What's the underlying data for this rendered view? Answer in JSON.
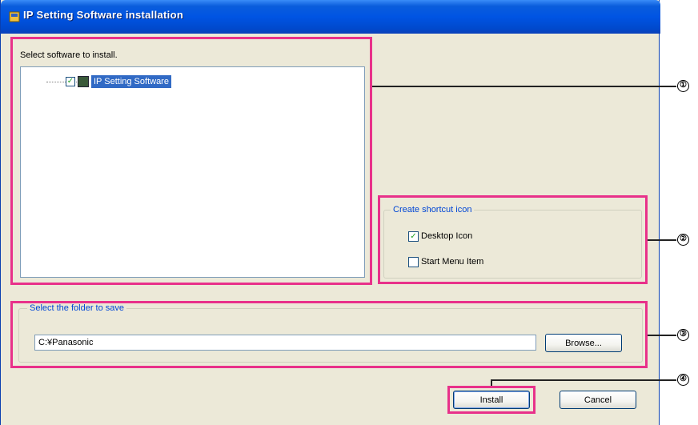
{
  "window": {
    "title": "IP Setting Software installation"
  },
  "software": {
    "label": "Select software to install.",
    "items": [
      {
        "label": "IP Setting Software",
        "checked": true,
        "selected": true
      }
    ]
  },
  "shortcut": {
    "legend": "Create shortcut icon",
    "options": [
      {
        "label": "Desktop Icon",
        "checked": true
      },
      {
        "label": "Start Menu Item",
        "checked": false
      }
    ]
  },
  "folder": {
    "legend": "Select the folder to save",
    "path": "C:¥Panasonic",
    "browse_label": "Browse..."
  },
  "buttons": {
    "install_label": "Install",
    "cancel_label": "Cancel"
  },
  "callouts": {
    "markers": [
      "①",
      "②",
      "③",
      "④"
    ]
  },
  "colors": {
    "highlight": "#e8318a",
    "titlebar": "#0054e3",
    "selection": "#316ac5",
    "group_legend": "#0046d5"
  }
}
